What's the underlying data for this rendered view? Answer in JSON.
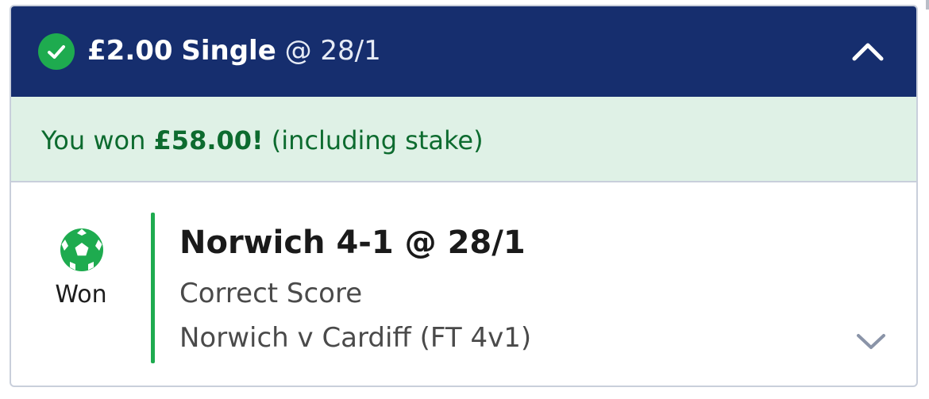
{
  "bet": {
    "stake": "£2.00",
    "type": "Single",
    "odds_label": "@ 28/1",
    "status_icon": "check-circle-icon",
    "collapse_icon": "chevron-up-icon"
  },
  "result": {
    "prefix": "You won",
    "amount": "£58.00!",
    "suffix": "(including stake)"
  },
  "selection": {
    "sport_icon": "football-icon",
    "status": "Won",
    "title": "Norwich 4-1 @ 28/1",
    "market": "Correct Score",
    "event": "Norwich v Cardiff (FT 4v1)",
    "expand_icon": "chevron-down-icon"
  },
  "colors": {
    "header_bg": "#162e6e",
    "win_banner_bg": "#dff1e6",
    "win_text": "#0d6b2f",
    "accent_green": "#1eab4f",
    "border": "#c9cfdb"
  }
}
